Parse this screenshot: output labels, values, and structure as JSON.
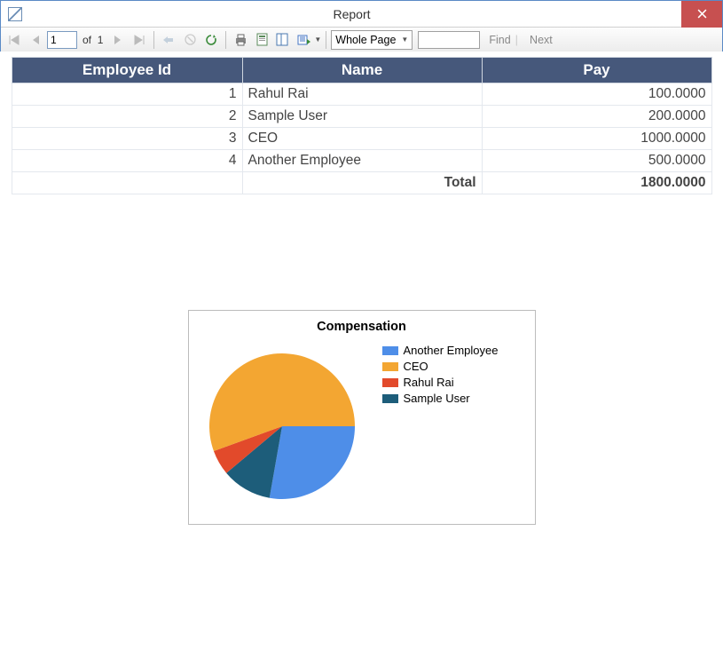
{
  "window": {
    "title": "Report",
    "close_tooltip": "Close"
  },
  "toolbar": {
    "page_input": "1",
    "of_label": "of",
    "total_pages": "1",
    "zoom_label": "Whole Page",
    "find_label": "Find",
    "next_label": "Next",
    "search_value": ""
  },
  "table": {
    "headers": {
      "id": "Employee Id",
      "name": "Name",
      "pay": "Pay"
    },
    "rows": [
      {
        "id": "1",
        "name": "Rahul Rai",
        "pay": "100.0000"
      },
      {
        "id": "2",
        "name": "Sample User",
        "pay": "200.0000"
      },
      {
        "id": "3",
        "name": "CEO",
        "pay": "1000.0000"
      },
      {
        "id": "4",
        "name": "Another Employee",
        "pay": "500.0000"
      }
    ],
    "total_label": "Total",
    "total_value": "1800.0000"
  },
  "chart_data": {
    "type": "pie",
    "title": "Compensation",
    "series": [
      {
        "name": "Another Employee",
        "value": 500,
        "color": "#4e8ee8"
      },
      {
        "name": "CEO",
        "value": 1000,
        "color": "#f3a632"
      },
      {
        "name": "Rahul Rai",
        "value": 100,
        "color": "#e24a2b"
      },
      {
        "name": "Sample User",
        "value": 200,
        "color": "#1d5d7a"
      }
    ]
  }
}
